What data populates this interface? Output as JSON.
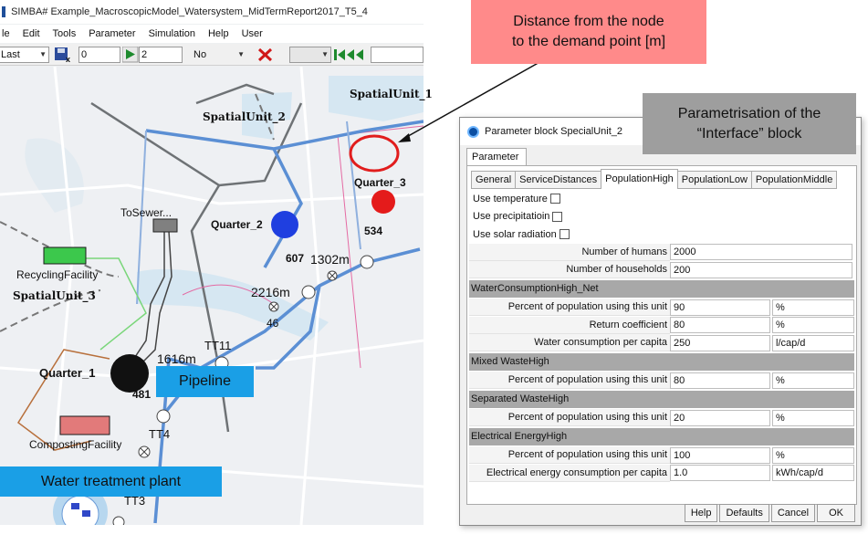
{
  "window": {
    "title": "SIMBA# Example_MacroscopicModel_Watersystem_MidTermReport2017_T5_4",
    "menu": [
      "le",
      "Edit",
      "Tools",
      "Parameter",
      "Simulation",
      "Help",
      "User"
    ]
  },
  "toolbar": {
    "combo1": "Last",
    "input1": "0",
    "input2": "2",
    "combo2": "No"
  },
  "map": {
    "labels": {
      "spatial_unit_1": "SpatialUnit_1",
      "spatial_unit_2": "SpatialUnit_2",
      "spatial_unit_3": "SpatialUnit_3",
      "quarter_1": "Quarter_1",
      "quarter_2": "Quarter_2",
      "quarter_3": "Quarter_3",
      "to_sewer": "ToSewer...",
      "recycling": "RecyclingFacility",
      "composting": "CompostingFacility",
      "d_1302": "1302m",
      "d_2216": "2216m",
      "d_1616": "1616m",
      "n_607": "607",
      "n_534": "534",
      "n_46": "46",
      "n_481": "481",
      "tt11": "TT11",
      "tt4": "TT4",
      "tt3": "TT3"
    },
    "colors": {
      "quarter_1": "#111111",
      "quarter_2": "#1f3fe0",
      "quarter_3": "#e41b1b",
      "recycling": "#3cc84c",
      "composting": "#e27a7a",
      "pipeline": "#5b8fd4"
    }
  },
  "annotations": {
    "distance_line1": "Distance from the node",
    "distance_line2": "to the demand point [m]",
    "param_line1": "Parametrisation of the",
    "param_line2": "“Interface” block",
    "pipeline": "Pipeline",
    "water_treatment": "Water treatment plant"
  },
  "dialog": {
    "title": "Parameter block SpecialUnit_2",
    "outer_tab": "Parameter",
    "tabs": [
      "General",
      "ServiceDistances",
      "PopulationHigh",
      "PopulationLow",
      "PopulationMiddle"
    ],
    "checks": {
      "temperature": "Use temperature",
      "precipitation": "Use precipitatioin",
      "solar": "Use solar radiation"
    },
    "fields": {
      "humans_label": "Number of humans",
      "humans_value": "2000",
      "households_label": "Number of households",
      "households_value": "200"
    },
    "sections": {
      "water": "WaterConsumptionHigh_Net",
      "mixed": "Mixed WasteHigh",
      "separated": "Separated WasteHigh",
      "electrical": "Electrical EnergyHigh"
    },
    "water": {
      "pop_label": "Percent of population using this unit",
      "pop_value": "90",
      "pop_unit": "%",
      "return_label": "Return coefficient",
      "return_value": "80",
      "return_unit": "%",
      "cons_label": "Water consumption per capita",
      "cons_value": "250",
      "cons_unit": "l/cap/d"
    },
    "mixed": {
      "pop_label": "Percent of population using this unit",
      "pop_value": "80",
      "pop_unit": "%"
    },
    "separated": {
      "pop_label": "Percent of population using this unit",
      "pop_value": "20",
      "pop_unit": "%"
    },
    "electrical": {
      "pop_label": "Percent of population using this unit",
      "pop_value": "100",
      "pop_unit": "%",
      "cons_label": "Electrical energy consumption per capita",
      "cons_value": "1.0",
      "cons_unit": "kWh/cap/d"
    },
    "buttons": {
      "help": "Help",
      "defaults": "Defaults",
      "cancel": "Cancel",
      "ok": "OK"
    }
  }
}
